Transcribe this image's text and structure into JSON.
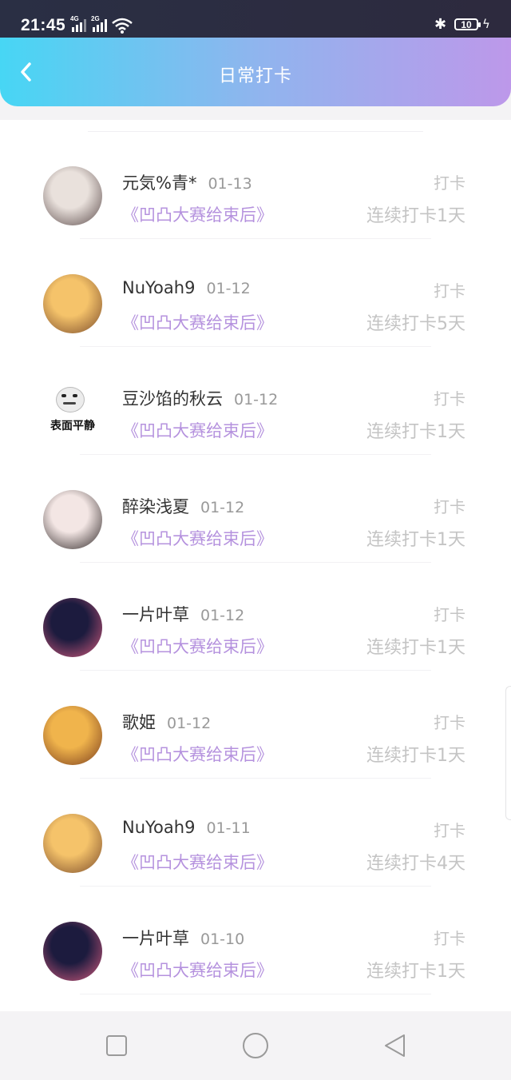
{
  "status_bar": {
    "time": "21:45",
    "net1": "4G",
    "net2": "2G",
    "battery": "10"
  },
  "header": {
    "title": "日常打卡"
  },
  "entries": [
    {
      "name": "元気%青*",
      "date": "01-13",
      "book": "《凹凸大赛给束后》",
      "action": "打卡",
      "streak": "连续打卡1天",
      "avatar_colors": [
        "#e9e1dc",
        "#5b4a4a"
      ]
    },
    {
      "name": "NuYoah9",
      "date": "01-12",
      "book": "《凹凸大赛给束后》",
      "action": "打卡",
      "streak": "连续打卡5天",
      "avatar_colors": [
        "#f5c36a",
        "#7a4a2a"
      ]
    },
    {
      "name": "豆沙馅的秋云",
      "date": "01-12",
      "book": "《凹凸大赛给束后》",
      "action": "打卡",
      "streak": "连续打卡1天",
      "avatar_text": "表面平静"
    },
    {
      "name": "醉染浅夏",
      "date": "01-12",
      "book": "《凹凸大赛给束后》",
      "action": "打卡",
      "streak": "连续打卡1天",
      "avatar_colors": [
        "#f3e6e4",
        "#2c2424"
      ]
    },
    {
      "name": "一片叶草",
      "date": "01-12",
      "book": "《凹凸大赛给束后》",
      "action": "打卡",
      "streak": "连续打卡1天",
      "avatar_colors": [
        "#1c1b3e",
        "#d45b7e"
      ]
    },
    {
      "name": "歌姫",
      "date": "01-12",
      "book": "《凹凸大赛给束后》",
      "action": "打卡",
      "streak": "连续打卡1天",
      "avatar_colors": [
        "#f0b44c",
        "#7a3c1c"
      ]
    },
    {
      "name": "NuYoah9",
      "date": "01-11",
      "book": "《凹凸大赛给束后》",
      "action": "打卡",
      "streak": "连续打卡4天",
      "avatar_colors": [
        "#f5c36a",
        "#7a4a2a"
      ]
    },
    {
      "name": "一片叶草",
      "date": "01-10",
      "book": "《凹凸大赛给束后》",
      "action": "打卡",
      "streak": "连续打卡1天",
      "avatar_colors": [
        "#1c1b3e",
        "#d45b7e"
      ]
    }
  ],
  "nav_bar": {
    "icons": [
      "square-icon",
      "circle-icon",
      "triangle-back-icon"
    ]
  }
}
